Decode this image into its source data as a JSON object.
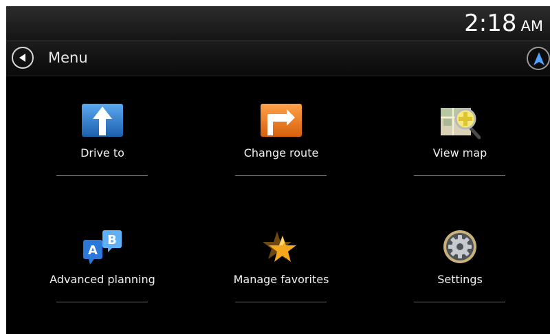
{
  "status_bar": {
    "time": "2:18",
    "ampm": "AM"
  },
  "header": {
    "back_icon": "back-arrow-icon",
    "title": "Menu",
    "nav_icon": "navigation-arrow-icon"
  },
  "menu_items": [
    {
      "label": "Drive to",
      "icon": "drive-to-arrow-icon",
      "color": "#2f78c8"
    },
    {
      "label": "Change route",
      "icon": "change-route-icon",
      "color": "#e8741c"
    },
    {
      "label": "View map",
      "icon": "view-map-magnifier-icon",
      "color": "#e6dc6a"
    },
    {
      "label": "Advanced planning",
      "icon": "ab-planning-icon",
      "color": "#3f8fe0"
    },
    {
      "label": "Manage favorites",
      "icon": "favorites-star-icon",
      "color": "#f0a21c"
    },
    {
      "label": "Settings",
      "icon": "settings-gear-icon",
      "color": "#c9b27a"
    }
  ]
}
